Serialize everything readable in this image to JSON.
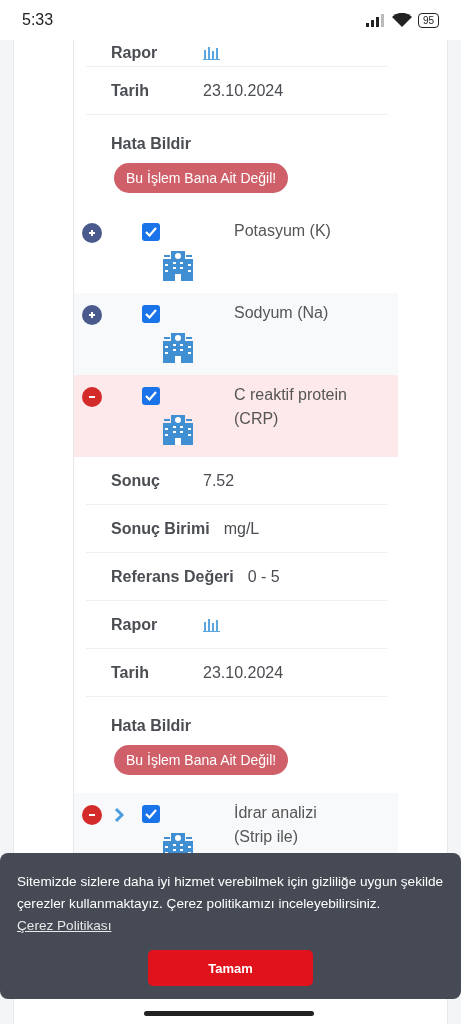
{
  "status_bar": {
    "time": "5:33",
    "battery": "95"
  },
  "top_details": {
    "rows": [
      {
        "kind": "chart",
        "label": "Rapor"
      },
      {
        "kind": "text",
        "label": "Tarih",
        "value": "23.10.2024"
      }
    ],
    "report_label": "Hata Bildir",
    "report_button": "Bu İşlem Bana Ait Değil!"
  },
  "tests": [
    {
      "name": "Potasyum (K)",
      "expanded": false,
      "checked": true,
      "selected": false,
      "has_children": false
    },
    {
      "name": "Sodyum (Na)",
      "expanded": false,
      "checked": true,
      "selected": false,
      "has_children": false
    },
    {
      "name": "C reaktif protein (CRP)",
      "expanded": true,
      "checked": true,
      "selected": true,
      "has_children": false,
      "details": {
        "rows": [
          {
            "kind": "text",
            "label": "Sonuç",
            "value": "7.52"
          },
          {
            "kind": "text",
            "label": "Sonuç Birimi",
            "value": "mg/L"
          },
          {
            "kind": "text",
            "label": "Referans Değeri",
            "value": "0 - 5"
          },
          {
            "kind": "chart",
            "label": "Rapor"
          },
          {
            "kind": "text",
            "label": "Tarih",
            "value": "23.10.2024"
          }
        ],
        "report_label": "Hata Bildir",
        "report_button": "Bu İşlem Bana Ait Değil!"
      }
    },
    {
      "name": "İdrar analizi (Strip ile)",
      "expanded": true,
      "checked": true,
      "selected": false,
      "has_children": true
    }
  ],
  "cookie_banner": {
    "text": "Sitemizde sizlere daha iyi hizmet verebilmek için gizliliğe uygun şekilde çerezler kullanmaktayız. Çerez politikamızı inceleyebilirsiniz.",
    "link": "Çerez Politikası",
    "button": "Tamam"
  }
}
